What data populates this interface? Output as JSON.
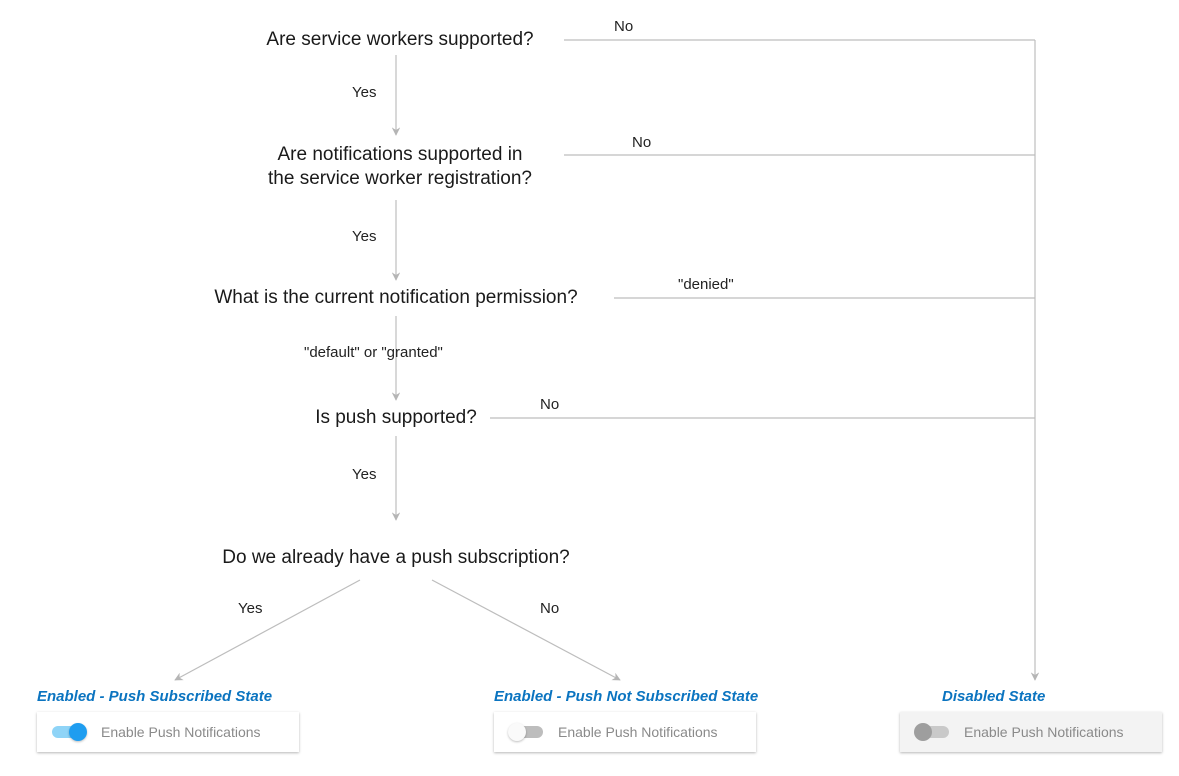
{
  "nodes": {
    "q1": "Are service workers supported?",
    "q2": "Are notifications supported in\nthe service worker registration?",
    "q3": "What is the current notification permission?",
    "q4": "Is push supported?",
    "q5": "Do we already have a push subscription?"
  },
  "edges": {
    "q1_no": "No",
    "q1_yes": "Yes",
    "q2_no": "No",
    "q2_yes": "Yes",
    "q3_denied": "\"denied\"",
    "q3_default": "\"default\" or \"granted\"",
    "q4_no": "No",
    "q4_yes": "Yes",
    "q5_yes": "Yes",
    "q5_no": "No"
  },
  "states": {
    "subscribed": {
      "title": "Enabled - Push Subscribed State",
      "label": "Enable Push Notifications"
    },
    "not_subscribed": {
      "title": "Enabled - Push Not Subscribed State",
      "label": "Enable Push Notifications"
    },
    "disabled": {
      "title": "Disabled State",
      "label": "Enable Push Notifications"
    }
  },
  "chart_data": {
    "type": "flowchart",
    "nodes": [
      {
        "id": "q1",
        "text": "Are service workers supported?"
      },
      {
        "id": "q2",
        "text": "Are notifications supported in the service worker registration?"
      },
      {
        "id": "q3",
        "text": "What is the current notification permission?"
      },
      {
        "id": "q4",
        "text": "Is push supported?"
      },
      {
        "id": "q5",
        "text": "Do we already have a push subscription?"
      },
      {
        "id": "s_sub",
        "text": "Enabled - Push Subscribed State",
        "terminal": true,
        "toggle": "on"
      },
      {
        "id": "s_nosub",
        "text": "Enabled - Push Not Subscribed State",
        "terminal": true,
        "toggle": "off"
      },
      {
        "id": "s_dis",
        "text": "Disabled State",
        "terminal": true,
        "toggle": "disabled"
      }
    ],
    "edges": [
      {
        "from": "q1",
        "to": "q2",
        "label": "Yes"
      },
      {
        "from": "q1",
        "to": "s_dis",
        "label": "No"
      },
      {
        "from": "q2",
        "to": "q3",
        "label": "Yes"
      },
      {
        "from": "q2",
        "to": "s_dis",
        "label": "No"
      },
      {
        "from": "q3",
        "to": "q4",
        "label": "\"default\" or \"granted\""
      },
      {
        "from": "q3",
        "to": "s_dis",
        "label": "\"denied\""
      },
      {
        "from": "q4",
        "to": "q5",
        "label": "Yes"
      },
      {
        "from": "q4",
        "to": "s_dis",
        "label": "No"
      },
      {
        "from": "q5",
        "to": "s_sub",
        "label": "Yes"
      },
      {
        "from": "q5",
        "to": "s_nosub",
        "label": "No"
      }
    ]
  }
}
